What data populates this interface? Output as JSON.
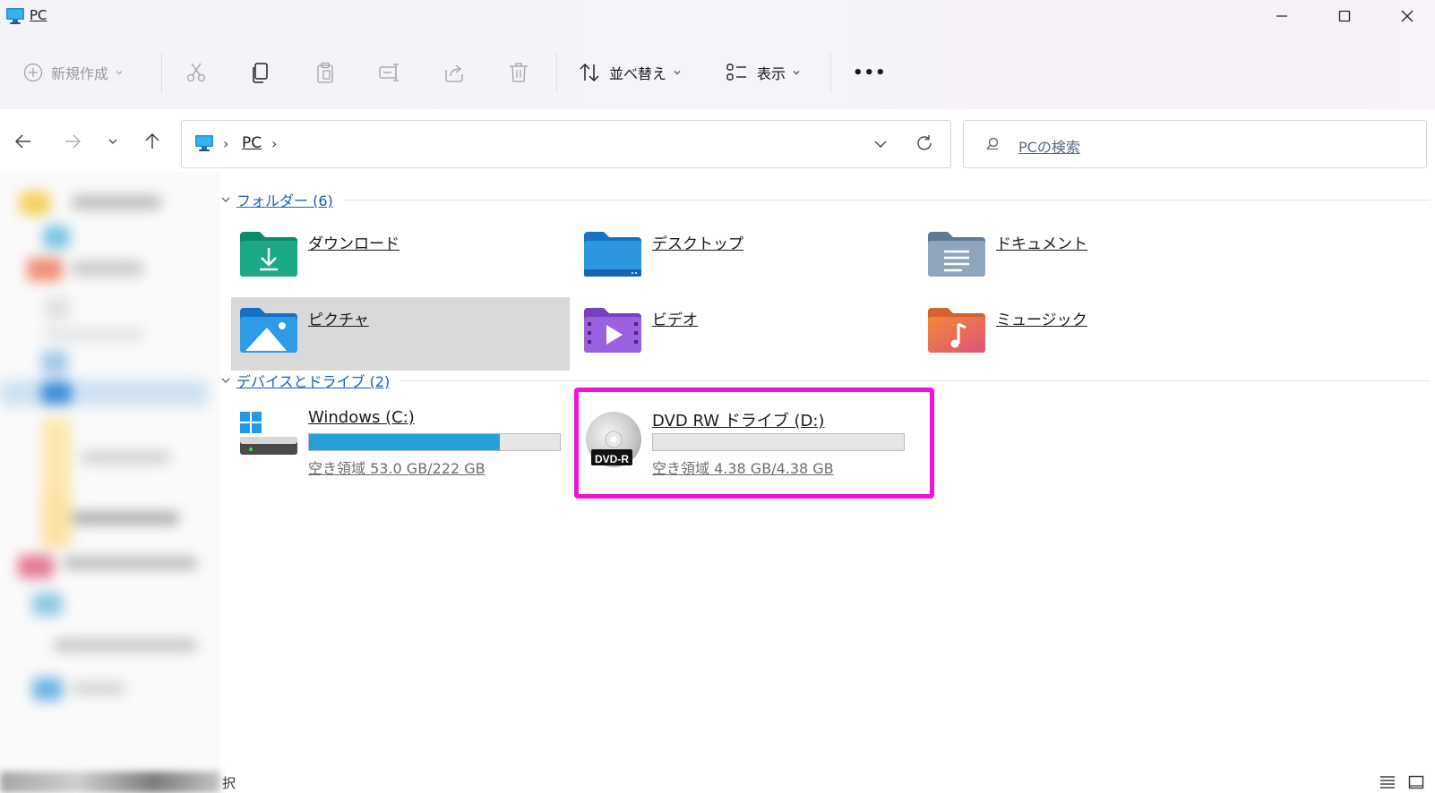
{
  "window": {
    "title": "PC"
  },
  "commands": {
    "new_label": "新規作成",
    "sort_label": "並べ替え",
    "view_label": "表示",
    "more_label": "•••"
  },
  "address": {
    "crumbs": [
      "PC"
    ],
    "separator": "›",
    "search_placeholder": "PCの検索"
  },
  "sections": {
    "folders_title": "フォルダー (6)",
    "devices_title": "デバイスとドライブ (2)"
  },
  "folders": [
    {
      "name": "ダウンロード",
      "icon": "downloads-folder-icon"
    },
    {
      "name": "デスクトップ",
      "icon": "desktop-folder-icon"
    },
    {
      "name": "ドキュメント",
      "icon": "documents-folder-icon"
    },
    {
      "name": "ピクチャ",
      "icon": "pictures-folder-icon"
    },
    {
      "name": "ビデオ",
      "icon": "videos-folder-icon"
    },
    {
      "name": "ミュージック",
      "icon": "music-folder-icon"
    }
  ],
  "drives": [
    {
      "name": "Windows (C:)",
      "free_text": "空き領域 53.0 GB/222 GB",
      "used_fraction": 0.761,
      "icon": "windows-drive-icon"
    },
    {
      "name": "DVD RW ドライブ (D:)",
      "free_text": "空き領域 4.38 GB/4.38 GB",
      "used_fraction": 0.0,
      "icon": "dvd-drive-icon",
      "badge": "DVD-R"
    }
  ],
  "status": {
    "text": "択"
  },
  "colors": {
    "accent": "#1a5fb4",
    "storage_bar": "#26a0da",
    "highlight": "#f211d8",
    "selection": "#d9d9d9"
  }
}
